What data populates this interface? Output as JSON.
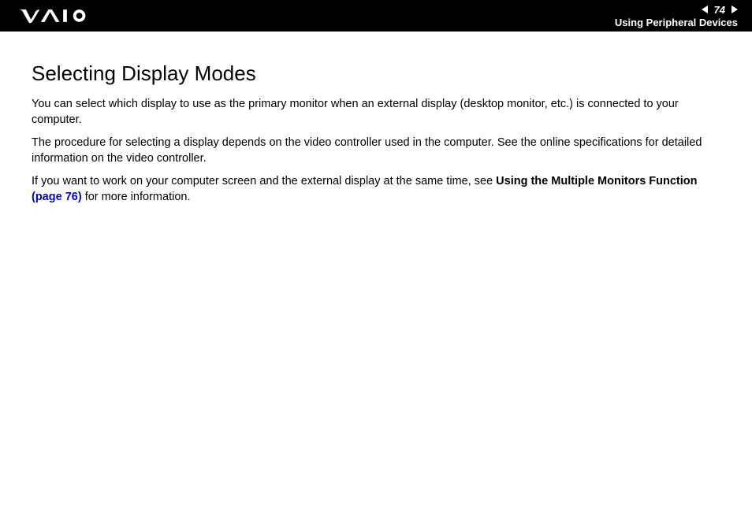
{
  "header": {
    "page_number": "74",
    "section": "Using Peripheral Devices"
  },
  "content": {
    "title": "Selecting Display Modes",
    "para1": "You can select which display to use as the primary monitor when an external display (desktop monitor, etc.) is connected to your computer.",
    "para2": "The procedure for selecting a display depends on the video controller used in the computer. See the online specifications for detailed information on the video controller.",
    "para3_pre": "If you want to work on your computer screen and the external display at the same time, see ",
    "para3_bold": "Using the Multiple Monitors Function ",
    "para3_link": "(page 76)",
    "para3_post": " for more information."
  }
}
